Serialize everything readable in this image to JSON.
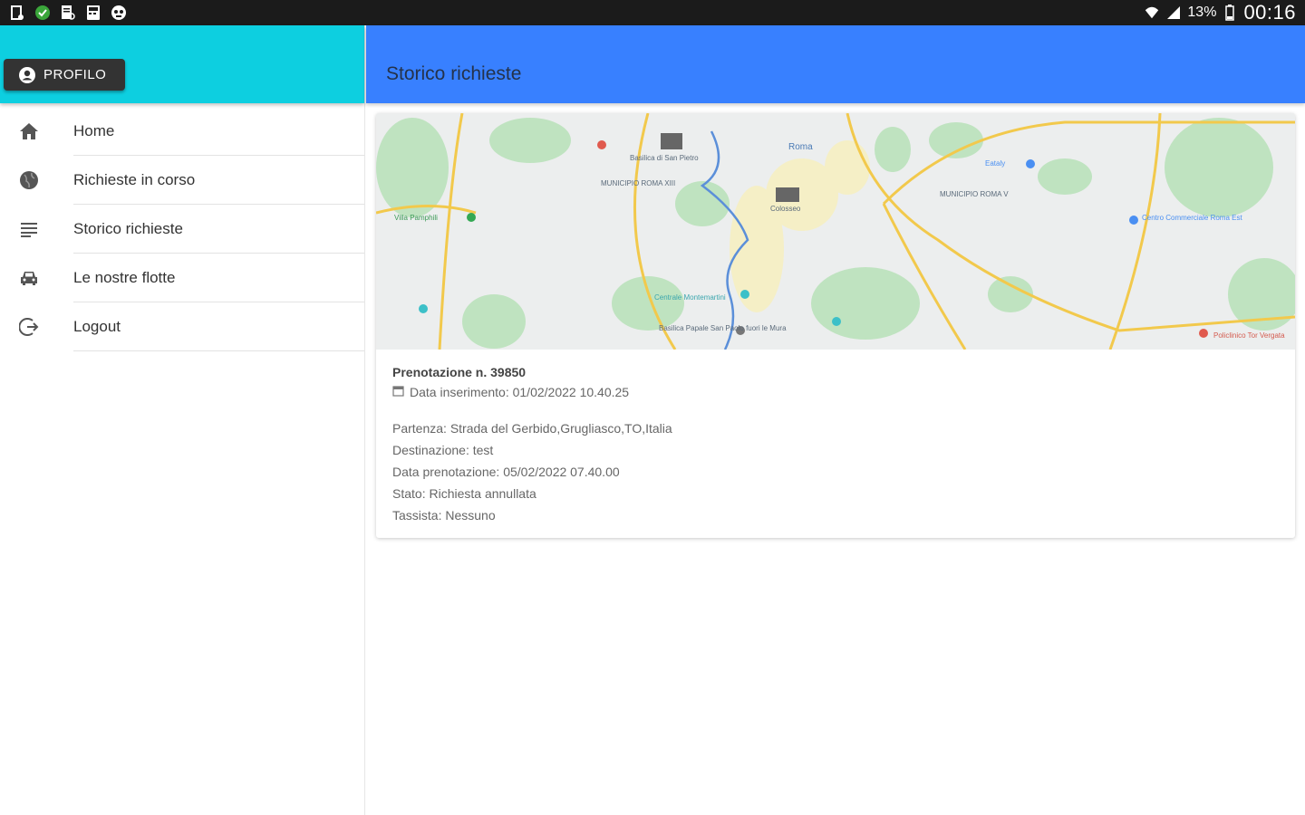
{
  "status_bar": {
    "battery_pct": "13%",
    "time": "00:16"
  },
  "drawer": {
    "profile_label": "PROFILO",
    "items": [
      {
        "label": "Home",
        "icon": "home-icon"
      },
      {
        "label": "Richieste in corso",
        "icon": "globe-icon"
      },
      {
        "label": "Storico richieste",
        "icon": "list-icon"
      },
      {
        "label": "Le nostre flotte",
        "icon": "car-icon"
      },
      {
        "label": "Logout",
        "icon": "logout-icon"
      }
    ]
  },
  "header": {
    "title": "Storico richieste"
  },
  "colors": {
    "drawer_header": "#0dcfe0",
    "toolbar": "#3880ff",
    "profile_button": "#333333"
  },
  "booking": {
    "title": "Prenotazione n. 39850",
    "inserted": "Data inserimento: 01/02/2022 10.40.25",
    "partenza": "Partenza: Strada del Gerbido,Grugliasco,TO,Italia",
    "destinazione": "Destinazione: test",
    "data_prenotazione": "Data prenotazione: 05/02/2022 07.40.00",
    "stato": "Stato: Richiesta annullata",
    "tassista": "Tassista: Nessuno"
  },
  "map": {
    "labels": {
      "roma": "Roma",
      "municipio_xiii": "MUNICIPIO ROMA XIII",
      "municipio_v": "MUNICIPIO ROMA V",
      "basilica": "Basilica di San Pietro",
      "colosseo": "Colosseo",
      "eataly": "Eataly",
      "centrale": "Centrale Montemartini",
      "basilica_paolo": "Basilica Papale San Paolo fuori le Mura",
      "policlinico": "Policlinico Tor Vergata",
      "centro_commerciale": "Centro Commerciale Roma Est",
      "villa": "Villa Pamphili"
    }
  }
}
